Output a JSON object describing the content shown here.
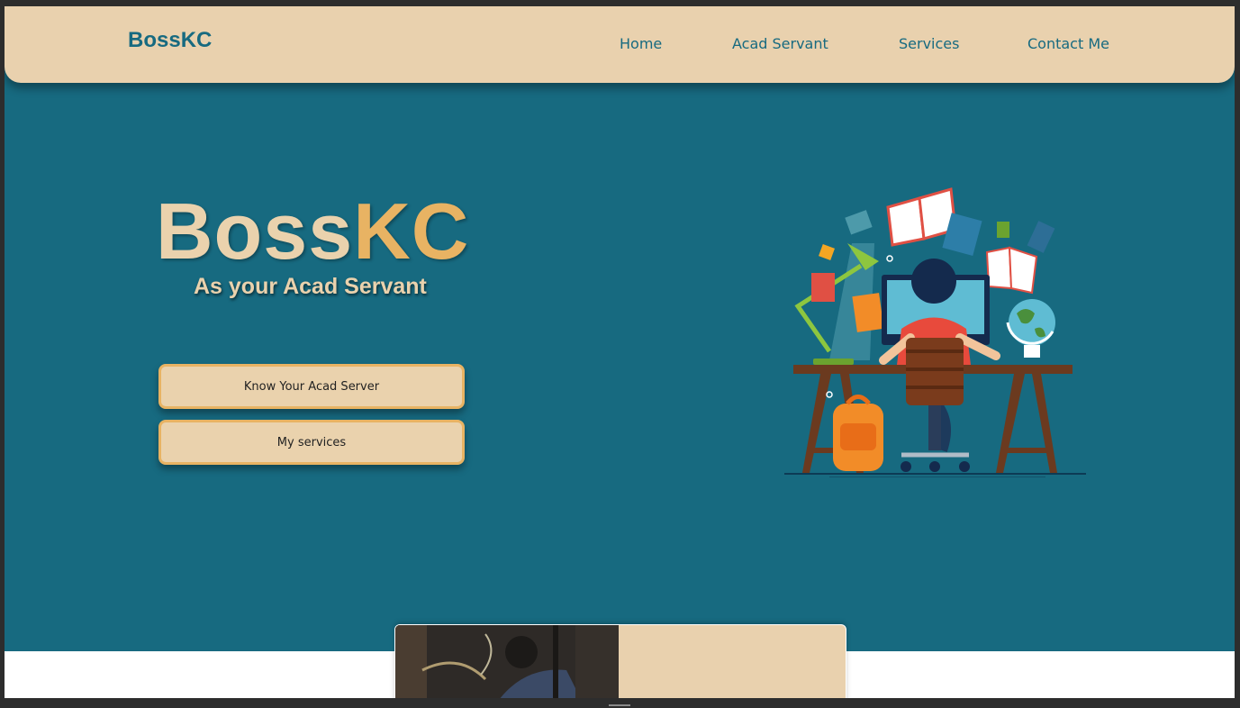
{
  "navbar": {
    "brand": "BossKC",
    "links": [
      "Home",
      "Acad Servant",
      "Services",
      "Contact Me"
    ]
  },
  "hero": {
    "title_part1": "Boss",
    "title_part2": "KC",
    "subtitle": "As your Acad Servant",
    "buttons": [
      "Know Your Acad Server",
      "My services"
    ],
    "illustration": "student-studying-at-desk-illustration"
  },
  "colors": {
    "primary_teal": "#176a80",
    "beige": "#e9d1ae",
    "gold": "#e8b363"
  }
}
